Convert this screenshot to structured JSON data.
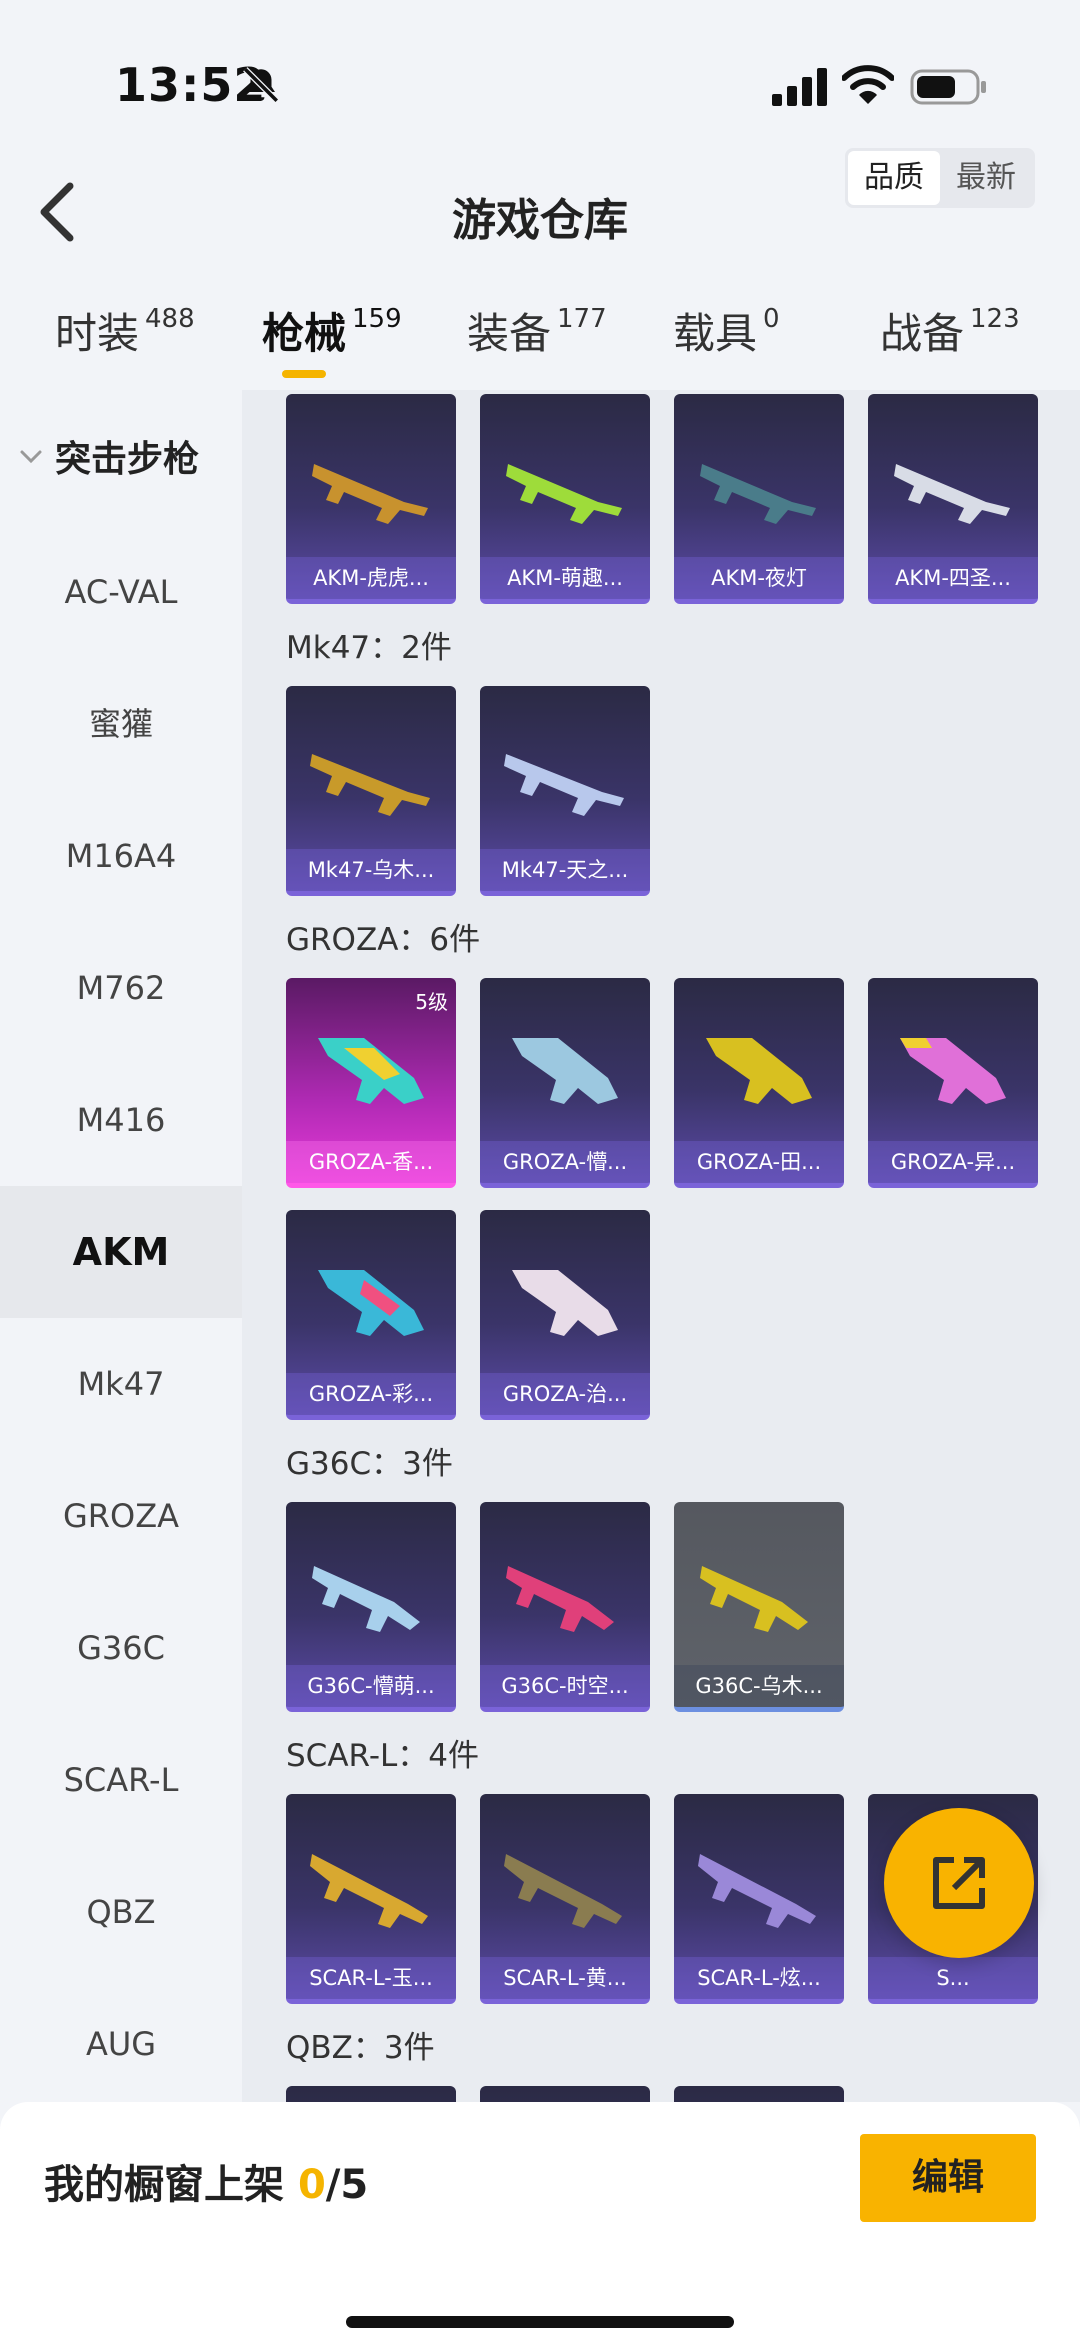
{
  "status": {
    "time": "13:52"
  },
  "header": {
    "title": "游戏仓库",
    "sort_options": [
      "品质",
      "最新"
    ],
    "sort_selected": "品质"
  },
  "tabs": [
    {
      "label": "时装",
      "count": "488"
    },
    {
      "label": "枪械",
      "count": "159"
    },
    {
      "label": "装备",
      "count": "177"
    },
    {
      "label": "载具",
      "count": "0"
    },
    {
      "label": "战备",
      "count": "123"
    }
  ],
  "active_tab": "枪械",
  "sidebar": {
    "category": "突击步枪",
    "items": [
      "AC-VAL",
      "蜜獾",
      "M16A4",
      "M762",
      "M416",
      "AKM",
      "Mk47",
      "GROZA",
      "G36C",
      "SCAR-L",
      "QBZ",
      "AUG"
    ],
    "active": "AKM"
  },
  "content": {
    "akm_row": [
      "AKM-虎虎...",
      "AKM-萌趣...",
      "AKM-夜灯",
      "AKM-四圣..."
    ],
    "groups": [
      {
        "title": "Mk47：2件",
        "items": [
          "Mk47-乌木...",
          "Mk47-天之..."
        ]
      },
      {
        "title": "GROZA：6件",
        "items": [
          "GROZA-香...",
          "GROZA-懵...",
          "GROZA-田...",
          "GROZA-异...",
          "GROZA-彩...",
          "GROZA-治..."
        ],
        "first_level": "5级"
      },
      {
        "title": "G36C：3件",
        "items": [
          "G36C-懵萌...",
          "G36C-时空...",
          "G36C-乌木..."
        ]
      },
      {
        "title": "SCAR-L：4件",
        "items": [
          "SCAR-L-玉...",
          "SCAR-L-黄...",
          "SCAR-L-炫...",
          "S..."
        ]
      },
      {
        "title": "QBZ：3件",
        "items": []
      }
    ]
  },
  "bottom": {
    "label": "我的橱窗上架 ",
    "current": "0",
    "total": "/5",
    "edit_label": "编辑"
  },
  "colors": {
    "accent": "#f9b300",
    "card_purple": "#3a3468",
    "card_pink": "#e63ad8"
  },
  "icons": {
    "fab": "share-icon",
    "back": "back-arrow-icon"
  }
}
